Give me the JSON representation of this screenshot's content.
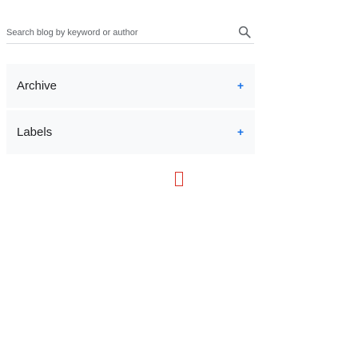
{
  "search": {
    "placeholder": "Search blog by keyword or author",
    "value": "",
    "icon": "search-icon"
  },
  "accordion": {
    "items": [
      {
        "label": "Archive",
        "toggle": "+"
      },
      {
        "label": "Labels",
        "toggle": "+"
      }
    ]
  },
  "colors": {
    "accent": "#1a73e8",
    "panel_bg": "#f8f9fa",
    "text": "#202124",
    "muted": "#5f6368",
    "cursor_outline": "#d93025"
  }
}
